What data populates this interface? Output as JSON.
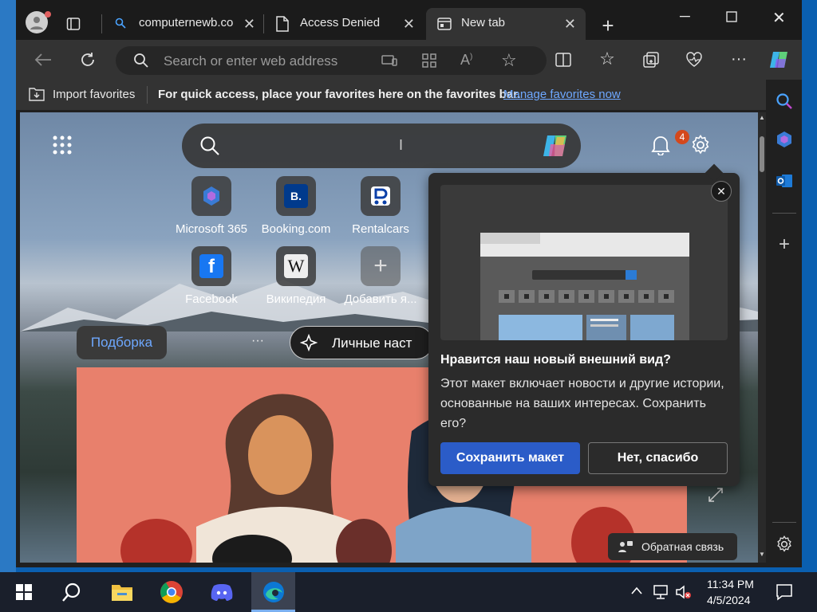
{
  "tabs": [
    {
      "label": "computernewb.co"
    },
    {
      "label": "Access Denied"
    },
    {
      "label": "New tab"
    }
  ],
  "toolbar": {
    "address_placeholder": "Search or enter web address"
  },
  "favbar": {
    "import_label": "Import favorites",
    "message": "For quick access, place your favorites here on the favorites bar.",
    "manage_link": "Manage favorites now"
  },
  "newtab": {
    "notification_count": "4",
    "tiles": [
      {
        "label": "Microsoft 365",
        "glyph": ""
      },
      {
        "label": "Booking.com",
        "glyph": "B."
      },
      {
        "label": "Rentalcars",
        "glyph": ""
      },
      {
        "label": "Facebook",
        "glyph": "f"
      },
      {
        "label": "Википедия",
        "glyph": "W"
      },
      {
        "label": "Добавить я...",
        "glyph": "+"
      }
    ],
    "feed_tab": "Подборка",
    "personalize": "Личные наст",
    "more": "···",
    "feedback": "Обратная связь"
  },
  "popup": {
    "title": "Нравится наш новый внешний вид?",
    "body": "Этот макет включает новости и другие истории, основанные на ваших интересах. Сохранить его?",
    "save_button": "Сохранить макет",
    "decline_button": "Нет, спасибо"
  },
  "taskbar": {
    "time": "11:34 PM",
    "date": "4/5/2024"
  },
  "colors": {
    "accent": "#2b5cc8",
    "link": "#6ea8ff",
    "badge": "#d4481c"
  }
}
